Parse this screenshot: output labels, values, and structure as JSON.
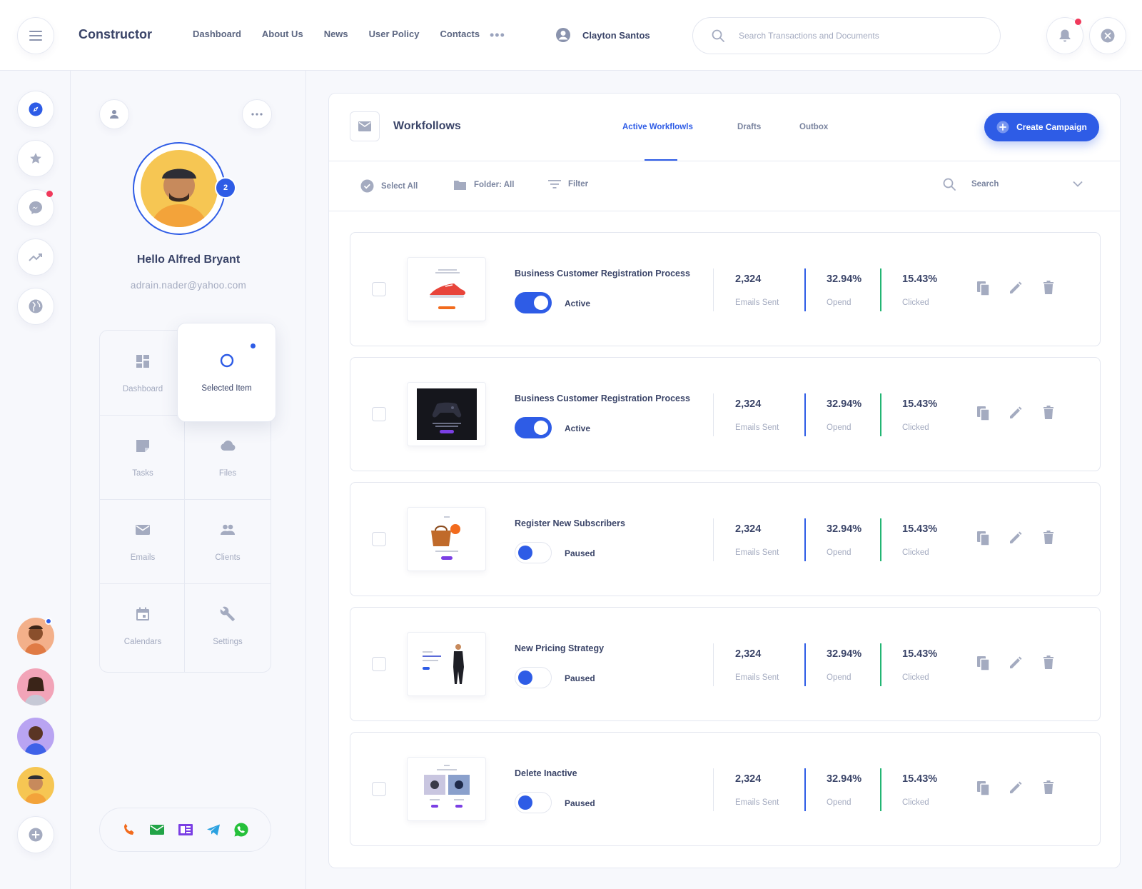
{
  "app": {
    "brand": "Constructor",
    "nav": [
      "Dashboard",
      "About Us",
      "News",
      "User Policy",
      "Contacts"
    ],
    "nav_more": "•••",
    "user_name": "Clayton Santos",
    "search_placeholder": "Search Transactions and Documents"
  },
  "profile": {
    "greeting": "Hello Alfred Bryant",
    "email": "adrain.nader@yahoo.com",
    "badge_count": "2",
    "tiles": [
      {
        "label": "Dashboard",
        "icon": "dashboard-icon"
      },
      {
        "label": "Selected Item",
        "icon": "circle-icon",
        "selected": true
      },
      {
        "label": "Tasks",
        "icon": "note-icon"
      },
      {
        "label": "Files",
        "icon": "cloud-icon"
      },
      {
        "label": "Emails",
        "icon": "mail-icon"
      },
      {
        "label": "Clients",
        "icon": "people-icon"
      },
      {
        "label": "Calendars",
        "icon": "calendar-icon"
      },
      {
        "label": "Settings",
        "icon": "wrench-icon"
      }
    ]
  },
  "workflows": {
    "title": "Workfollows",
    "tabs": [
      "Active Workflowls",
      "Drafts",
      "Outbox"
    ],
    "active_tab": 0,
    "create_label": "Create Campaign",
    "toolbar": {
      "select_all": "Select All",
      "folder": "Folder: All",
      "filter": "Filter",
      "search_placeholder": "Search"
    },
    "rows": [
      {
        "name": "Business Customer Registration Process",
        "status": "Active",
        "enabled": true,
        "emails_sent": "2,324",
        "opened": "32.94%",
        "clicked": "15.43%",
        "thumb": "sneaker"
      },
      {
        "name": "Business Customer Registration Process",
        "status": "Active",
        "enabled": true,
        "emails_sent": "2,324",
        "opened": "32.94%",
        "clicked": "15.43%",
        "thumb": "gamepad"
      },
      {
        "name": "Register New Subscribers",
        "status": "Paused",
        "enabled": false,
        "emails_sent": "2,324",
        "opened": "32.94%",
        "clicked": "15.43%",
        "thumb": "bag"
      },
      {
        "name": "New Pricing Strategy",
        "status": "Paused",
        "enabled": false,
        "emails_sent": "2,324",
        "opened": "32.94%",
        "clicked": "15.43%",
        "thumb": "fashion"
      },
      {
        "name": "Delete Inactive",
        "status": "Paused",
        "enabled": false,
        "emails_sent": "2,324",
        "opened": "32.94%",
        "clicked": "15.43%",
        "thumb": "watches"
      }
    ],
    "stat_labels": {
      "emails_sent": "Emails Sent",
      "opened": "Opend",
      "clicked": "Clicked"
    }
  },
  "colors": {
    "accent": "#2e5ce6",
    "notification": "#f0395b",
    "clicked_line": "#22b573",
    "phone": "#f26b1d",
    "mail": "#22a447",
    "calendar": "#7b3fe4",
    "telegram": "#2aa1e0",
    "whatsapp": "#25c03a"
  }
}
